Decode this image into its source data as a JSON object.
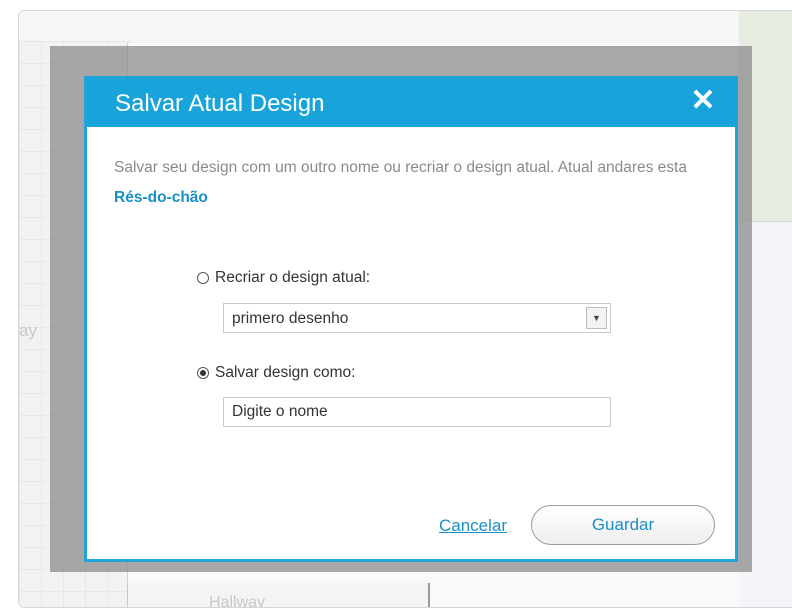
{
  "background": {
    "side_label": "ay",
    "bottom_label": "Hallway"
  },
  "dialog": {
    "title": "Salvar Atual Design",
    "close_icon": "close-icon",
    "description_text": "Salvar seu design com um outro nome ou recriar o design atual. Atual andares esta ",
    "floor_name": "Rés-do-chão",
    "option_recreate": {
      "label": "Recriar o design atual:",
      "selected": false,
      "select_value": "primero desenho"
    },
    "option_save_as": {
      "label": "Salvar design como:",
      "selected": true,
      "input_value": "Digite o nome"
    },
    "cancel_label": "Cancelar",
    "save_label": "Guardar"
  },
  "colors": {
    "header": "#18a3da",
    "link": "#1a8fc6"
  }
}
